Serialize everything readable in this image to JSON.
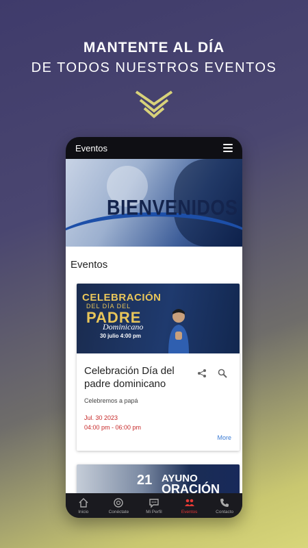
{
  "promo": {
    "line1": "MANTENTE AL DÍA",
    "line2": "DE TODOS NUESTROS EVENTOS"
  },
  "app": {
    "title": "Eventos"
  },
  "banner": {
    "heading": "BIENVENIDOS"
  },
  "section": {
    "title": "Eventos"
  },
  "events": [
    {
      "flyer": {
        "line1": "CELEBRACIÓN",
        "line2": "DEL DÍA DEL",
        "line3": "PADRE",
        "line4": "Dominicano",
        "date": "30 julio  4:00 pm"
      },
      "title": "Celebración Día del padre dominicano",
      "description": "Celebremos a papá",
      "date": "Jul. 30 2023",
      "time": "04:00 pm - 06:00 pm",
      "more_label": "More"
    },
    {
      "flyer": {
        "number": "21",
        "line1": "AYUNO",
        "line2": "ORACIÓN"
      }
    }
  ],
  "tabs": [
    {
      "label": "Inicio",
      "icon": "home-icon",
      "active": false
    },
    {
      "label": "Conéctate",
      "icon": "connect-icon",
      "active": false
    },
    {
      "label": "Mi Perfil",
      "icon": "profile-icon",
      "active": false
    },
    {
      "label": "Eventos",
      "icon": "events-icon",
      "active": true
    },
    {
      "label": "Contacto",
      "icon": "phone-icon",
      "active": false
    }
  ],
  "colors": {
    "accent_red": "#e53935",
    "link_blue": "#3a7bd5",
    "chevron_gold": "#d8d27a"
  }
}
